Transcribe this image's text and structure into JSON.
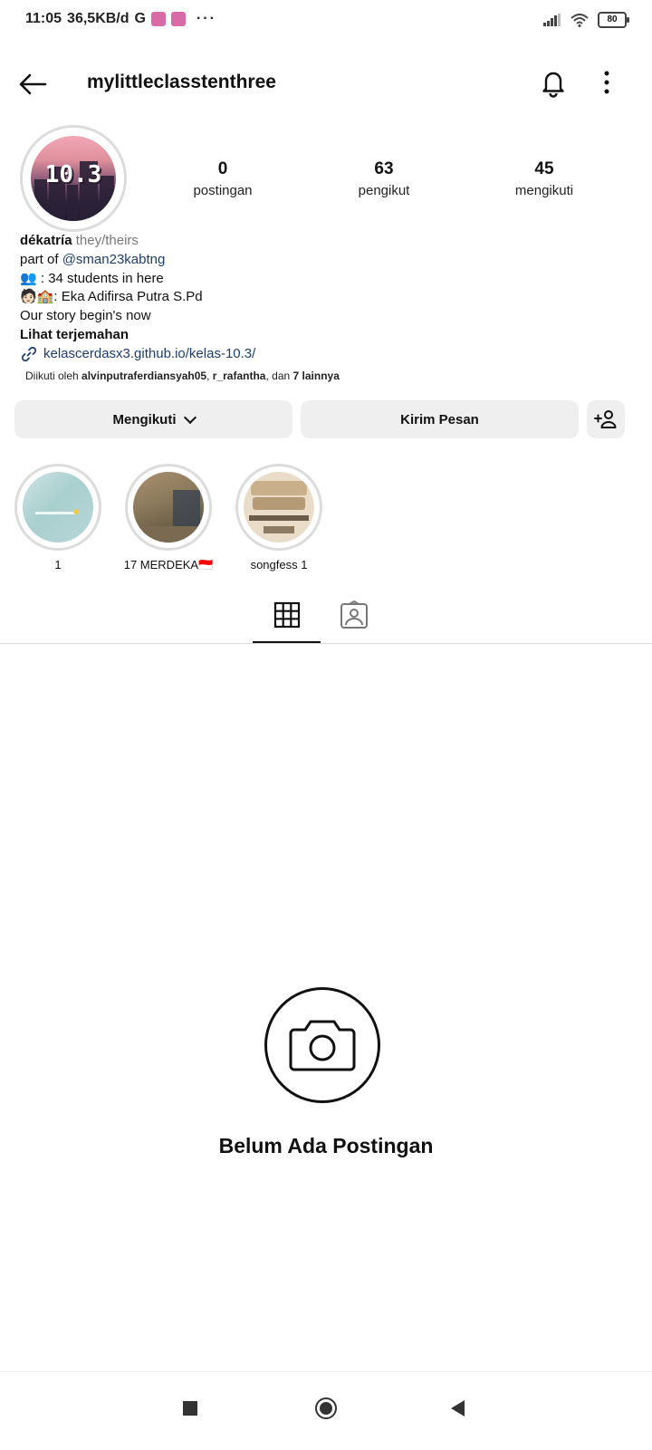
{
  "status_bar": {
    "time": "11:05",
    "speed": "36,5KB/d",
    "g_icon": "G",
    "more": "···",
    "battery": "80"
  },
  "header": {
    "username": "mylittleclasstenthree",
    "icons": [
      "back-arrow-icon",
      "bell-icon",
      "more-vertical-icon"
    ]
  },
  "profile": {
    "avatar_text": "10.3",
    "stats": [
      {
        "value": "0",
        "label": "postingan"
      },
      {
        "value": "63",
        "label": "pengikut"
      },
      {
        "value": "45",
        "label": "mengikuti"
      }
    ],
    "name": "dékatría",
    "pronouns": "they/theirs",
    "bio_part_prefix": "part of",
    "bio_mention": "@sman23kabtng",
    "bio_students_emoji": "👥",
    "bio_students": " : 34 students in here",
    "bio_teacher_emoji": "🧑🏻🏫",
    "bio_teacher": ": Eka Adifirsa Putra S.Pd",
    "bio_story": "Our story begin's now",
    "see_translation": "Lihat terjemahan",
    "link": "kelascerdasx3.github.io/kelas-10.3/",
    "followed_prefix": "Diikuti oleh",
    "followed_user1": "alvinputraferdiansyah05",
    "followed_sep": ",",
    "followed_user2": "r_rafantha",
    "followed_and": ", dan",
    "followed_others": "7 lainnya"
  },
  "actions": {
    "following_label": "Mengikuti",
    "message_label": "Kirim Pesan"
  },
  "highlights": [
    {
      "label": "1"
    },
    {
      "label": "17 MERDEKA🇮🇩"
    },
    {
      "label": "songfess 1"
    }
  ],
  "tabs": [
    "grid-icon",
    "tagged-icon"
  ],
  "empty": {
    "title": "Belum Ada Postingan"
  },
  "colors": {
    "link": "#1d3d6e",
    "button_bg": "#efefef"
  }
}
